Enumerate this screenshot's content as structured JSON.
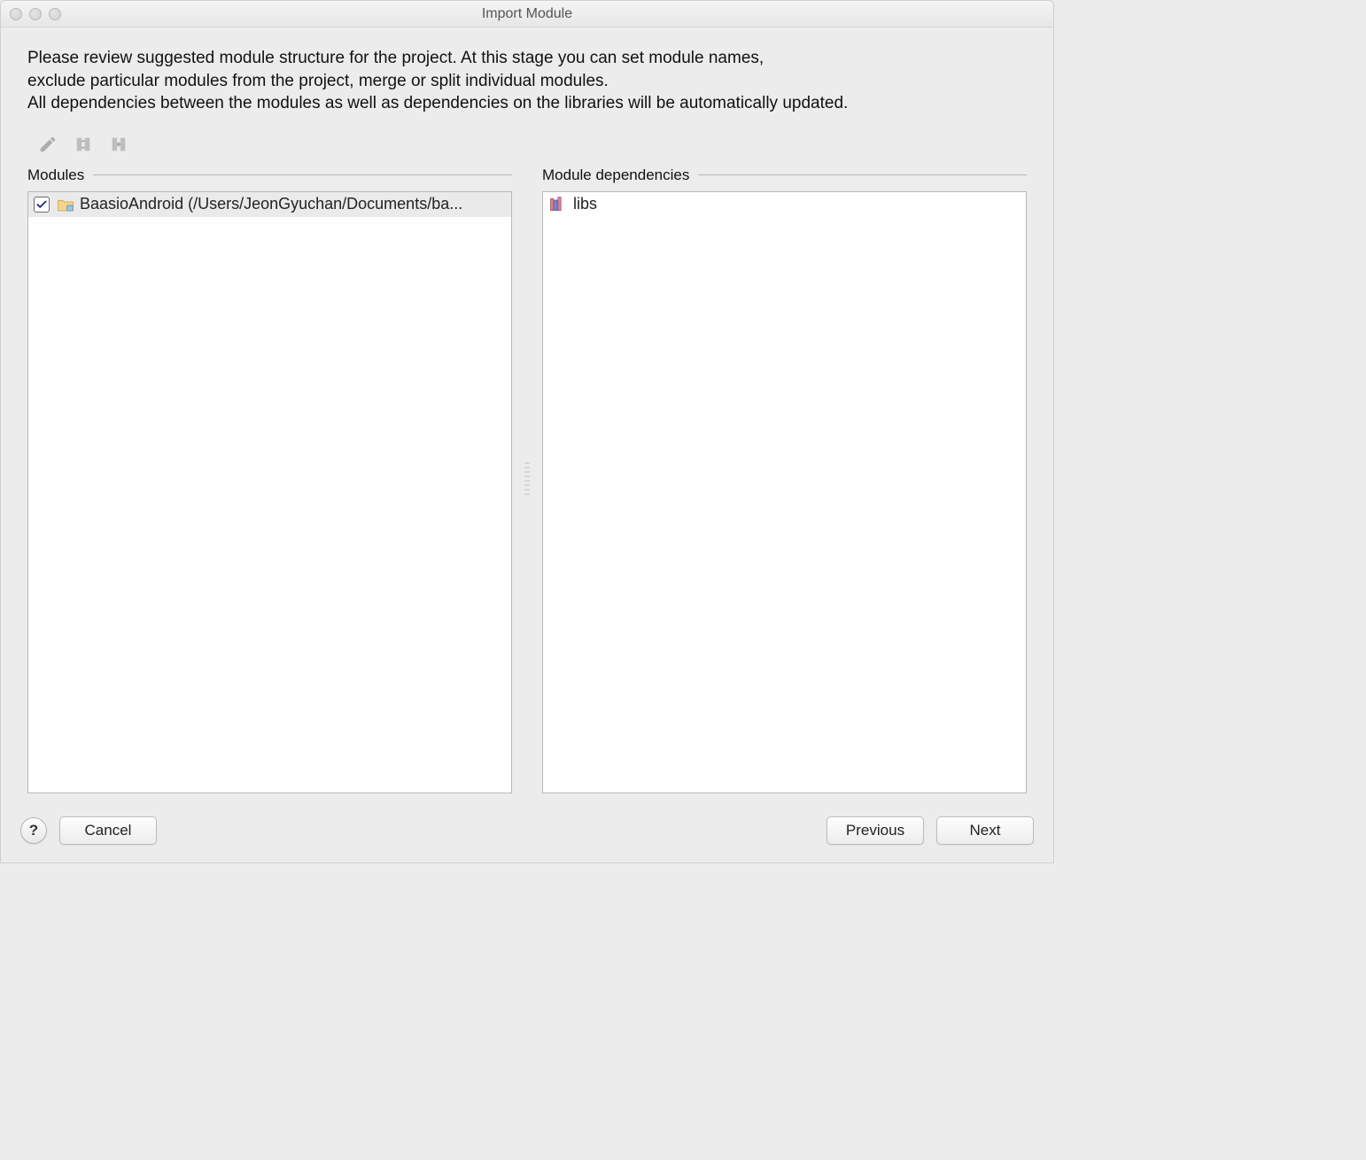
{
  "window": {
    "title": "Import Module"
  },
  "description": {
    "line1": "Please review suggested module structure for the project. At this stage you can set module names,",
    "line2": "exclude particular modules from the project, merge or split individual modules.",
    "line3": "All dependencies between the modules as well as dependencies on the libraries will be automatically updated."
  },
  "panes": {
    "modules_label": "Modules",
    "dependencies_label": "Module dependencies"
  },
  "modules": [
    {
      "checked": true,
      "selected": true,
      "text": "BaasioAndroid (/Users/JeonGyuchan/Documents/ba..."
    }
  ],
  "dependencies": [
    {
      "text": "libs"
    }
  ],
  "footer": {
    "help": "?",
    "cancel": "Cancel",
    "previous": "Previous",
    "next": "Next"
  }
}
